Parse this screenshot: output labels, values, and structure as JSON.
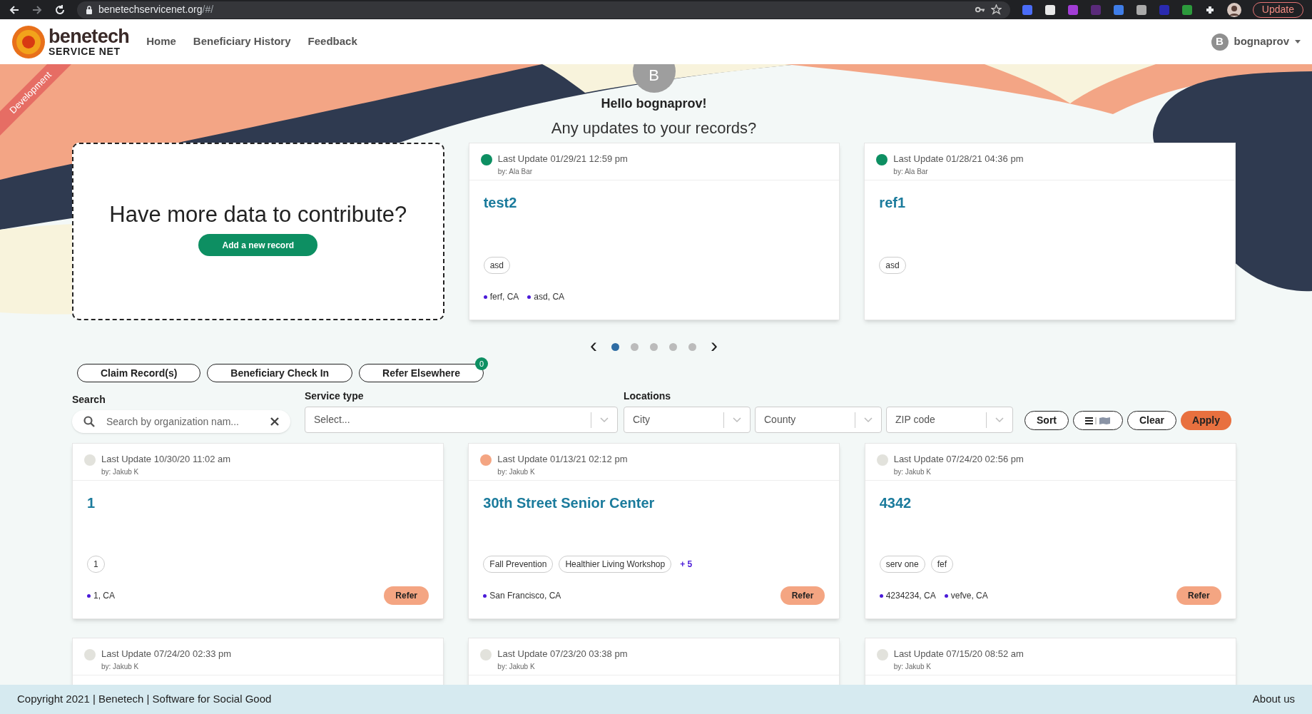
{
  "browser": {
    "url_host": "benetechservicenet.org",
    "url_path": "/#/",
    "update_button": "Update"
  },
  "nav": {
    "logo_title": "benetech",
    "logo_subtitle": "SERVICE NET",
    "links": [
      "Home",
      "Beneficiary History",
      "Feedback"
    ],
    "user_initial": "B",
    "user_name": "bognaprov"
  },
  "ribbon": "Development",
  "greeting": {
    "avatar_initial": "B",
    "hello": "Hello bognaprov!",
    "question": "Any updates to your records?"
  },
  "contribute": {
    "title": "Have more data to contribute?",
    "button": "Add a new record"
  },
  "recent_cards": [
    {
      "color": "#0d8f62",
      "last_update": "Last Update 01/29/21 12:59 pm",
      "by": "by: Ala Bar",
      "title": "test2",
      "tags": [
        "asd"
      ],
      "locations": [
        "ferf, CA",
        "asd, CA"
      ]
    },
    {
      "color": "#0d8f62",
      "last_update": "Last Update 01/28/21 04:36 pm",
      "by": "by: Ala Bar",
      "title": "ref1",
      "tags": [
        "asd"
      ]
    }
  ],
  "carousel": {
    "prev": "‹",
    "next": "›",
    "dots": [
      {
        "selected": true
      },
      {
        "selected": false
      },
      {
        "selected": false
      },
      {
        "selected": false
      },
      {
        "selected": false
      }
    ]
  },
  "actions": [
    {
      "label": "Claim Record(s)"
    },
    {
      "label": "Beneficiary Check In"
    },
    {
      "label": "Refer Elsewhere",
      "badge": "0"
    }
  ],
  "filters": {
    "search_label": "Search",
    "search_placeholder": "Search by organization nam...",
    "service_type_label": "Service type",
    "service_type_placeholder": "Select...",
    "locations_label": "Locations",
    "location_fields": [
      "City",
      "County",
      "ZIP code"
    ],
    "buttons": [
      {
        "kind": "outline",
        "label": "Sort"
      },
      {
        "kind": "toggle"
      },
      {
        "kind": "outline",
        "label": "Clear"
      },
      {
        "kind": "primary",
        "label": "Apply"
      }
    ]
  },
  "results": [
    {
      "color": "#e2e2dc",
      "last_update": "Last Update 10/30/20 11:02 am",
      "by": "by: Jakub K",
      "title": "1",
      "tags": [
        "1"
      ],
      "locations": [
        "1, CA"
      ],
      "refer": "Refer"
    },
    {
      "color": "#f4a582",
      "last_update": "Last Update 01/13/21 02:12 pm",
      "by": "by: Jakub K",
      "title": "30th Street Senior Center",
      "tags": [
        "Fall Prevention",
        "Healthier Living Workshop"
      ],
      "more": "+ 5",
      "locations": [
        "San Francisco, CA"
      ],
      "refer": "Refer"
    },
    {
      "color": "#e2e2dc",
      "last_update": "Last Update 07/24/20 02:56 pm",
      "by": "by: Jakub K",
      "title": "4342",
      "tags": [
        "serv one",
        "fef"
      ],
      "locations": [
        "4234234, CA",
        "vefve, CA"
      ],
      "refer": "Refer"
    },
    {
      "color": "#e2e2dc",
      "last_update": "Last Update 07/24/20 02:33 pm",
      "by": "by: Jakub K"
    },
    {
      "color": "#e2e2dc",
      "last_update": "Last Update 07/23/20 03:38 pm",
      "by": "by: Jakub K"
    },
    {
      "color": "#e2e2dc",
      "last_update": "Last Update 07/15/20 08:52 am",
      "by": "by: Jakub K"
    }
  ],
  "footer": {
    "copyright": "Copyright 2021 | Benetech | Software for Social Good",
    "about": "About us"
  }
}
